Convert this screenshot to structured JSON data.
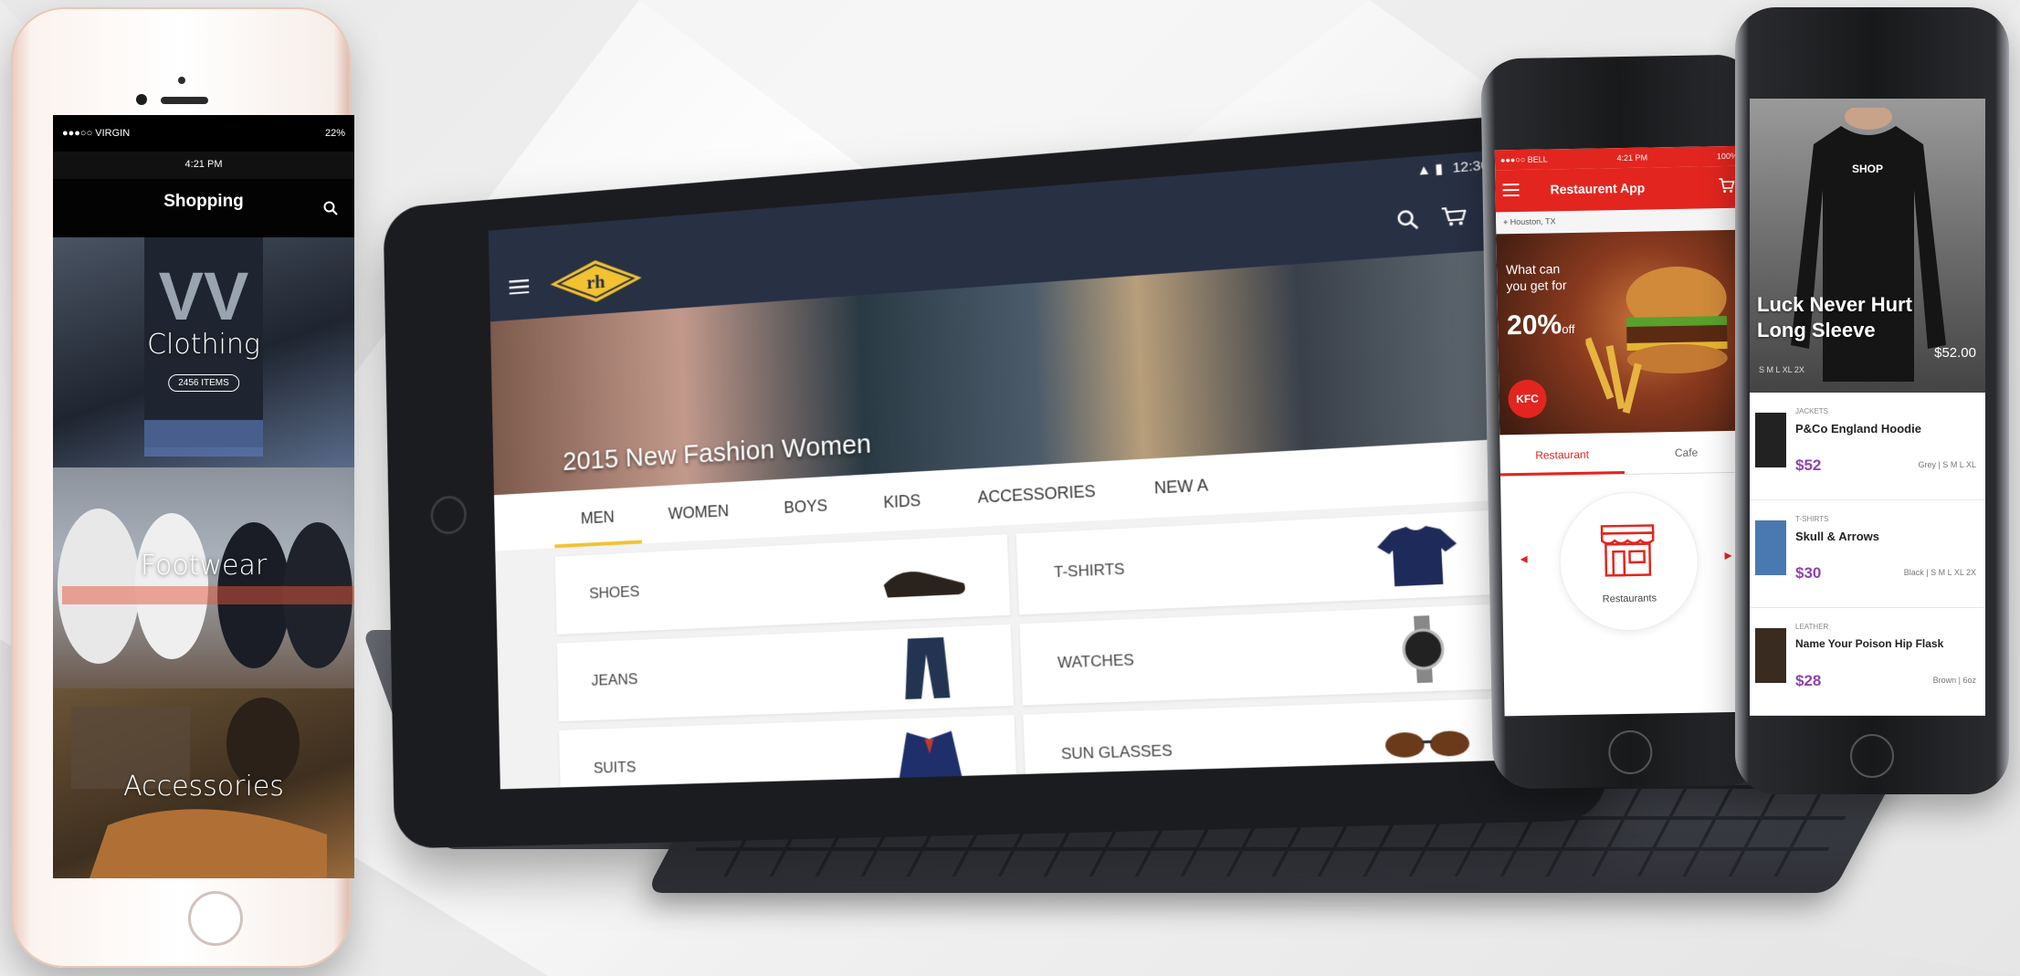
{
  "colors": {
    "tablet_bar": "#283044",
    "tab_accent": "#f2c230",
    "restaurant_red": "#e3251f",
    "shop_price": "#8e44ad"
  },
  "left_phone": {
    "status_left": "●●●○○ VIRGIN",
    "status_right": "22%",
    "time": "4:21 PM",
    "title": "Shopping",
    "search_icon": "search-icon",
    "categories": [
      {
        "name": "Clothing",
        "count": "2456 ITEMS"
      },
      {
        "name": "Footwear",
        "count": ""
      },
      {
        "name": "Accessories",
        "count": ""
      }
    ]
  },
  "tablet": {
    "status_time": "12:30",
    "logo_text": "rh",
    "menu_icon": "hamburger-icon",
    "search_icon": "search-icon",
    "cart_icon": "cart-icon",
    "hero_text": "2015 New Fashion Women",
    "tabs": [
      {
        "label": "MEN",
        "active": true
      },
      {
        "label": "WOMEN"
      },
      {
        "label": "BOYS"
      },
      {
        "label": "KIDS"
      },
      {
        "label": "ACCESSORIES"
      },
      {
        "label": "NEW A"
      }
    ],
    "products": [
      {
        "label": "SHOES",
        "icon": "shoes-icon"
      },
      {
        "label": "T-SHIRTS",
        "icon": "tshirt-icon"
      },
      {
        "label": "JEANS",
        "icon": "jeans-icon"
      },
      {
        "label": "WATCHES",
        "icon": "watch-icon"
      },
      {
        "label": "SUITS",
        "icon": "suit-icon"
      },
      {
        "label": "SUN GLASSES",
        "icon": "sunglasses-icon"
      }
    ]
  },
  "restaurant_phone": {
    "status_left": "●●●○○ BELL",
    "status_time": "4:21 PM",
    "status_right": "100%",
    "title": "Restaurent App",
    "location": "Houston, TX",
    "promo_line1": "What can you get for",
    "promo_big": "20%",
    "promo_suffix": "off",
    "brand_badge": "KFC",
    "tabs": [
      "Restaurant",
      "Cafe"
    ],
    "center_label": "Restaurants"
  },
  "shop_phone": {
    "hero_label": "SHOP",
    "hero_title_1": "Luck Never Hurt",
    "hero_title_2": "Long Sleeve",
    "hero_price": "$52.00",
    "hero_sizes": "S M L XL 2X",
    "items": [
      {
        "category": "JACKETS",
        "name": "P&Co England Hoodie",
        "price": "$52",
        "meta": "Grey  |  S M L XL"
      },
      {
        "category": "T-SHIRTS",
        "name": "Skull & Arrows",
        "price": "$30",
        "meta": "Black  |  S M L XL 2X"
      },
      {
        "category": "LEATHER",
        "name": "Name Your Poison Hip Flask",
        "price": "$28",
        "meta": "Brown  |  6oz"
      }
    ]
  }
}
